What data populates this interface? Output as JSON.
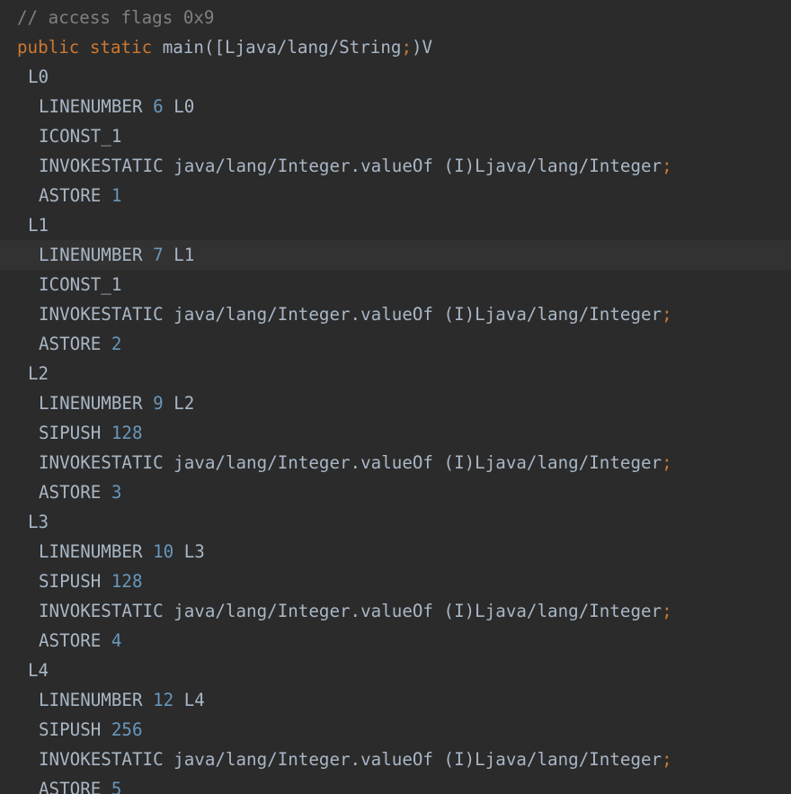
{
  "editor": {
    "colors": {
      "background": "#2b2b2b",
      "current_line": "#323232",
      "comment": "#808080",
      "keyword": "#cc7832",
      "text": "#a9b7c6",
      "number": "#6897bb"
    },
    "lines": [
      {
        "tokens": [
          {
            "t": "// access flags 0x9",
            "k": "comment"
          }
        ],
        "indent": 0
      },
      {
        "tokens": [
          {
            "t": "public",
            "k": "keyword"
          },
          {
            "t": " ",
            "k": "plain"
          },
          {
            "t": "static",
            "k": "keyword"
          },
          {
            "t": " main([Ljava/lang/String",
            "k": "plain"
          },
          {
            "t": ";",
            "k": "punct"
          },
          {
            "t": ")V",
            "k": "plain"
          }
        ],
        "indent": 0
      },
      {
        "tokens": [
          {
            "t": "L0",
            "k": "plain"
          }
        ],
        "indent": 1
      },
      {
        "tokens": [
          {
            "t": "LINENUMBER ",
            "k": "plain"
          },
          {
            "t": "6",
            "k": "number"
          },
          {
            "t": " L0",
            "k": "plain"
          }
        ],
        "indent": 2
      },
      {
        "tokens": [
          {
            "t": "ICONST_1",
            "k": "plain"
          }
        ],
        "indent": 2
      },
      {
        "tokens": [
          {
            "t": "INVOKESTATIC java/lang/Integer.valueOf (I)Ljava/lang/Integer",
            "k": "plain"
          },
          {
            "t": ";",
            "k": "punct"
          }
        ],
        "indent": 2
      },
      {
        "tokens": [
          {
            "t": "ASTORE ",
            "k": "plain"
          },
          {
            "t": "1",
            "k": "number"
          }
        ],
        "indent": 2
      },
      {
        "tokens": [
          {
            "t": "L1",
            "k": "plain"
          }
        ],
        "indent": 1
      },
      {
        "tokens": [
          {
            "t": "LINENUMBER ",
            "k": "plain"
          },
          {
            "t": "7",
            "k": "number"
          },
          {
            "t": " L1",
            "k": "plain"
          }
        ],
        "indent": 2,
        "current": true
      },
      {
        "tokens": [
          {
            "t": "ICONST_1",
            "k": "plain"
          }
        ],
        "indent": 2
      },
      {
        "tokens": [
          {
            "t": "INVOKESTATIC java/lang/Integer.valueOf (I)Ljava/lang/Integer",
            "k": "plain"
          },
          {
            "t": ";",
            "k": "punct"
          }
        ],
        "indent": 2
      },
      {
        "tokens": [
          {
            "t": "ASTORE ",
            "k": "plain"
          },
          {
            "t": "2",
            "k": "number"
          }
        ],
        "indent": 2
      },
      {
        "tokens": [
          {
            "t": "L2",
            "k": "plain"
          }
        ],
        "indent": 1
      },
      {
        "tokens": [
          {
            "t": "LINENUMBER ",
            "k": "plain"
          },
          {
            "t": "9",
            "k": "number"
          },
          {
            "t": " L2",
            "k": "plain"
          }
        ],
        "indent": 2
      },
      {
        "tokens": [
          {
            "t": "SIPUSH ",
            "k": "plain"
          },
          {
            "t": "128",
            "k": "number"
          }
        ],
        "indent": 2
      },
      {
        "tokens": [
          {
            "t": "INVOKESTATIC java/lang/Integer.valueOf (I)Ljava/lang/Integer",
            "k": "plain"
          },
          {
            "t": ";",
            "k": "punct"
          }
        ],
        "indent": 2
      },
      {
        "tokens": [
          {
            "t": "ASTORE ",
            "k": "plain"
          },
          {
            "t": "3",
            "k": "number"
          }
        ],
        "indent": 2
      },
      {
        "tokens": [
          {
            "t": "L3",
            "k": "plain"
          }
        ],
        "indent": 1
      },
      {
        "tokens": [
          {
            "t": "LINENUMBER ",
            "k": "plain"
          },
          {
            "t": "10",
            "k": "number"
          },
          {
            "t": " L3",
            "k": "plain"
          }
        ],
        "indent": 2
      },
      {
        "tokens": [
          {
            "t": "SIPUSH ",
            "k": "plain"
          },
          {
            "t": "128",
            "k": "number"
          }
        ],
        "indent": 2
      },
      {
        "tokens": [
          {
            "t": "INVOKESTATIC java/lang/Integer.valueOf (I)Ljava/lang/Integer",
            "k": "plain"
          },
          {
            "t": ";",
            "k": "punct"
          }
        ],
        "indent": 2
      },
      {
        "tokens": [
          {
            "t": "ASTORE ",
            "k": "plain"
          },
          {
            "t": "4",
            "k": "number"
          }
        ],
        "indent": 2
      },
      {
        "tokens": [
          {
            "t": "L4",
            "k": "plain"
          }
        ],
        "indent": 1
      },
      {
        "tokens": [
          {
            "t": "LINENUMBER ",
            "k": "plain"
          },
          {
            "t": "12",
            "k": "number"
          },
          {
            "t": " L4",
            "k": "plain"
          }
        ],
        "indent": 2
      },
      {
        "tokens": [
          {
            "t": "SIPUSH ",
            "k": "plain"
          },
          {
            "t": "256",
            "k": "number"
          }
        ],
        "indent": 2
      },
      {
        "tokens": [
          {
            "t": "INVOKESTATIC java/lang/Integer.valueOf (I)Ljava/lang/Integer",
            "k": "plain"
          },
          {
            "t": ";",
            "k": "punct"
          }
        ],
        "indent": 2
      },
      {
        "tokens": [
          {
            "t": "ASTORE ",
            "k": "plain"
          },
          {
            "t": "5",
            "k": "number"
          }
        ],
        "indent": 2
      }
    ]
  }
}
